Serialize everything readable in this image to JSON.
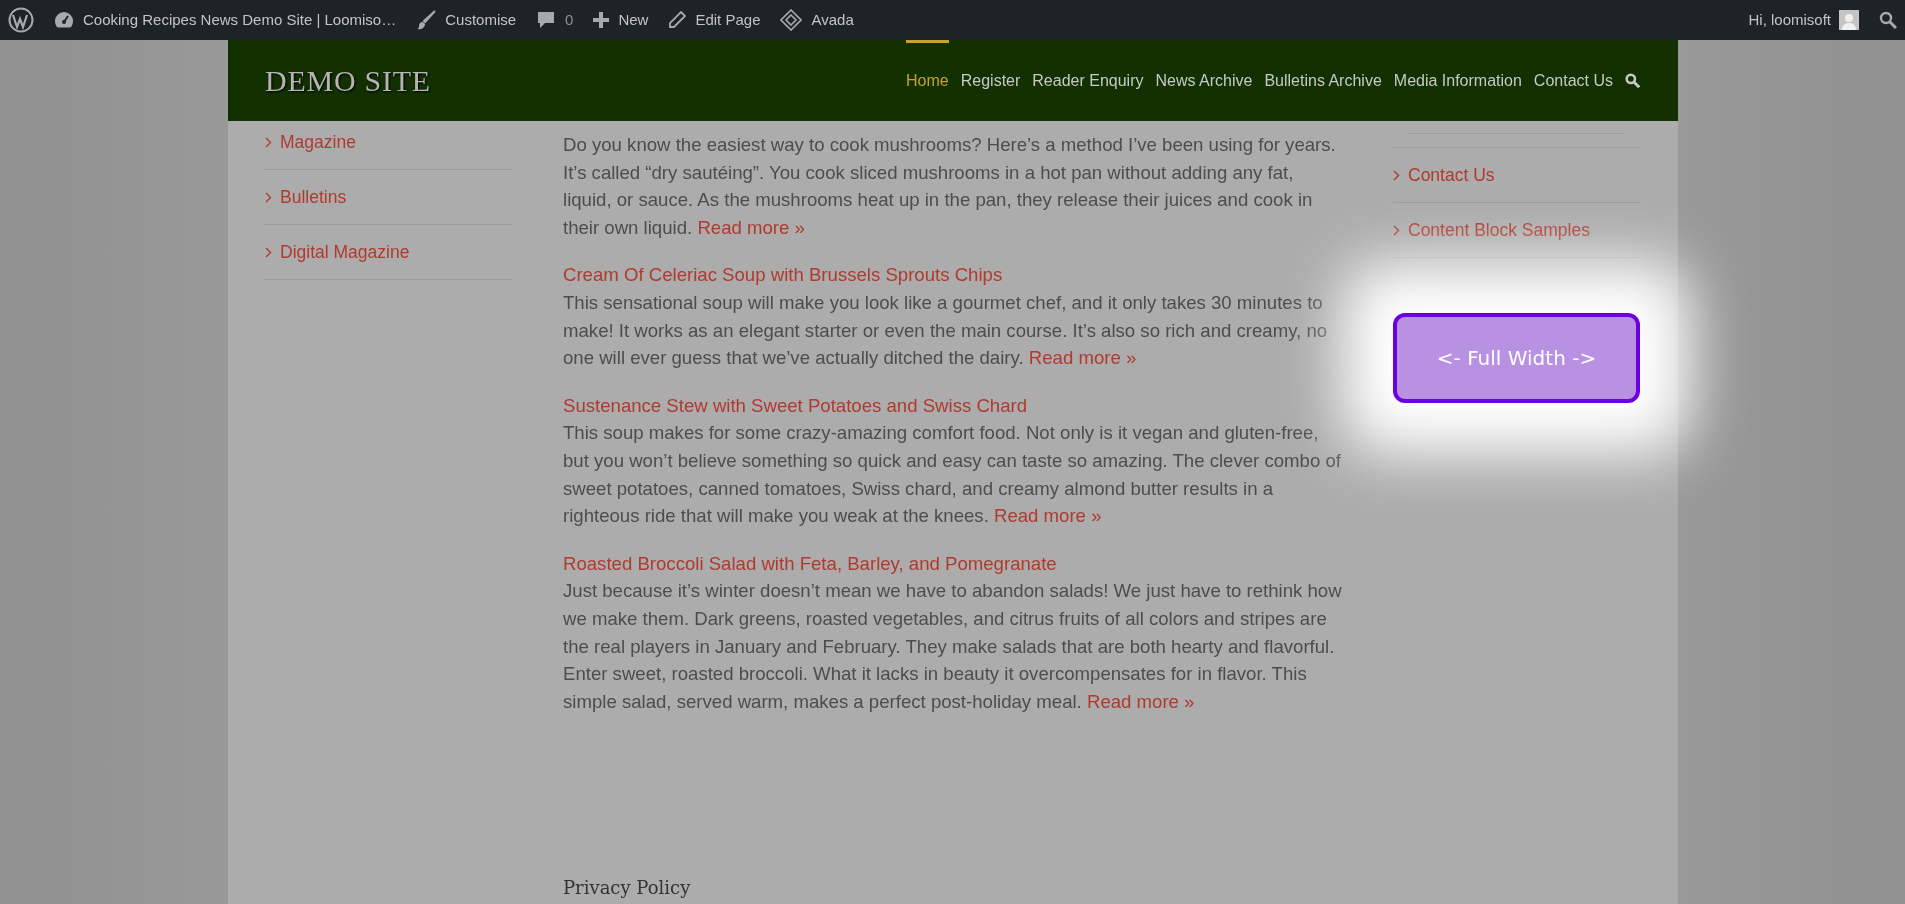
{
  "admin_bar": {
    "items": [
      {
        "kind": "wordpress"
      },
      {
        "kind": "dashboard",
        "label": "Cooking Recipes News Demo Site | Loomiso…"
      },
      {
        "kind": "brush",
        "label": "Customise"
      },
      {
        "kind": "comment",
        "label": "0"
      },
      {
        "kind": "plus",
        "label": "New"
      },
      {
        "kind": "pencil",
        "label": "Edit Page"
      },
      {
        "kind": "avada",
        "label": "Avada"
      }
    ],
    "greeting": "Hi, loomisoft"
  },
  "header": {
    "logo": "DEMO SITE",
    "nav": [
      {
        "label": "Home",
        "selected": true
      },
      {
        "label": "Register",
        "selected": false
      },
      {
        "label": "Reader Enquiry",
        "selected": false
      },
      {
        "label": "News Archive",
        "selected": false
      },
      {
        "label": "Bulletins Archive",
        "selected": false
      },
      {
        "label": "Media Information",
        "selected": false
      },
      {
        "label": "Contact Us",
        "selected": false
      }
    ]
  },
  "left_sidebar": {
    "items": [
      "Magazine",
      "Bulletins",
      "Digital Magazine"
    ]
  },
  "articles": [
    {
      "excerpt": "Do you know the easiest way to cook mushrooms? Here’s a method I’ve been using for years. It’s called “dry sautéing”. You cook sliced mushrooms in a hot pan without adding any fat, liquid, or sauce. As the mushrooms heat up in the pan, they release their juices and cook in their own liquid.",
      "link": "Read more »"
    },
    {
      "title": "Cream Of Celeriac Soup with Brussels Sprouts Chips",
      "excerpt": "This sensational soup will make you look like a gourmet chef, and it only takes 30 minutes to make! It works as an elegant starter or even the main course. It’s also so rich and creamy, no one will ever guess that we’ve actually ditched the dairy.",
      "link": "Read more »"
    },
    {
      "title": "Sustenance Stew with Sweet Potatoes and Swiss Chard",
      "excerpt": "This soup makes for some crazy-amazing comfort food. Not only is it vegan and gluten-free, but you won’t believe something so quick and easy can taste so amazing. The clever combo of sweet potatoes, canned tomatoes, Swiss chard, and creamy almond butter results in a righteous ride that will make you weak at the knees.",
      "link": "Read more »"
    },
    {
      "title": "Roasted Broccoli Salad with Feta, Barley, and Pomegranate",
      "excerpt": "Just because it’s winter doesn’t mean we have to abandon salads! We just have to rethink how we make them. Dark greens, roasted vegetables, and citrus fruits of all colors and stripes are the real players in January and February. They make salads that are both hearty and flavorful. Enter sweet, roasted broccoli. What it lacks in beauty it overcompensates for in flavor. This simple salad, served warm, makes a perfect post-holiday meal.",
      "link": "Read more »"
    }
  ],
  "right_sidebar": {
    "items": [
      "Contact Us",
      "Content Block Samples"
    ],
    "button": "<- Full Width ->"
  },
  "footer": {
    "heading": "Privacy Policy"
  }
}
